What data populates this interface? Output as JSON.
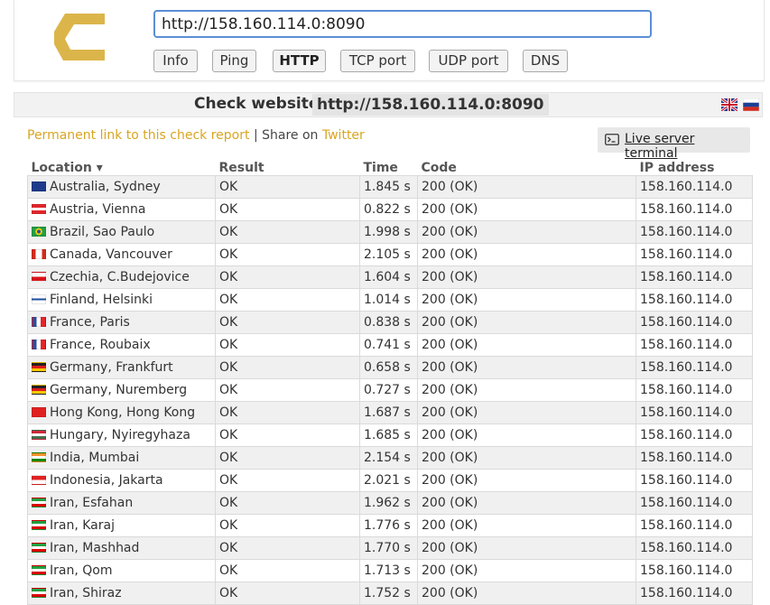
{
  "header": {
    "url_value": "http://158.160.114.0:8090",
    "buttons": [
      "Info",
      "Ping",
      "HTTP",
      "TCP port",
      "UDP port",
      "DNS"
    ],
    "active_button": "HTTP"
  },
  "title": {
    "label": "Check website",
    "url": "http://158.160.114.0:8090"
  },
  "links": {
    "permanent": "Permanent link to this check report",
    "separator": "|",
    "share": "Share on",
    "twitter": "Twitter",
    "terminal": "Live server terminal"
  },
  "table": {
    "headers": [
      "Location ▾",
      "Result",
      "Time",
      "Code",
      "IP address"
    ],
    "rows": [
      {
        "flag": "au",
        "location": "Australia, Sydney",
        "result": "OK",
        "time": "1.845 s",
        "code": "200 (OK)",
        "ip": "158.160.114.0"
      },
      {
        "flag": "at",
        "location": "Austria, Vienna",
        "result": "OK",
        "time": "0.822 s",
        "code": "200 (OK)",
        "ip": "158.160.114.0"
      },
      {
        "flag": "br",
        "location": "Brazil, Sao Paulo",
        "result": "OK",
        "time": "1.998 s",
        "code": "200 (OK)",
        "ip": "158.160.114.0"
      },
      {
        "flag": "ca",
        "location": "Canada, Vancouver",
        "result": "OK",
        "time": "2.105 s",
        "code": "200 (OK)",
        "ip": "158.160.114.0"
      },
      {
        "flag": "cz",
        "location": "Czechia, C.Budejovice",
        "result": "OK",
        "time": "1.604 s",
        "code": "200 (OK)",
        "ip": "158.160.114.0"
      },
      {
        "flag": "fi",
        "location": "Finland, Helsinki",
        "result": "OK",
        "time": "1.014 s",
        "code": "200 (OK)",
        "ip": "158.160.114.0"
      },
      {
        "flag": "fr",
        "location": "France, Paris",
        "result": "OK",
        "time": "0.838 s",
        "code": "200 (OK)",
        "ip": "158.160.114.0"
      },
      {
        "flag": "fr",
        "location": "France, Roubaix",
        "result": "OK",
        "time": "0.741 s",
        "code": "200 (OK)",
        "ip": "158.160.114.0"
      },
      {
        "flag": "de",
        "location": "Germany, Frankfurt",
        "result": "OK",
        "time": "0.658 s",
        "code": "200 (OK)",
        "ip": "158.160.114.0"
      },
      {
        "flag": "de",
        "location": "Germany, Nuremberg",
        "result": "OK",
        "time": "0.727 s",
        "code": "200 (OK)",
        "ip": "158.160.114.0"
      },
      {
        "flag": "hk",
        "location": "Hong Kong, Hong Kong",
        "result": "OK",
        "time": "1.687 s",
        "code": "200 (OK)",
        "ip": "158.160.114.0"
      },
      {
        "flag": "hu",
        "location": "Hungary, Nyiregyhaza",
        "result": "OK",
        "time": "1.685 s",
        "code": "200 (OK)",
        "ip": "158.160.114.0"
      },
      {
        "flag": "in",
        "location": "India, Mumbai",
        "result": "OK",
        "time": "2.154 s",
        "code": "200 (OK)",
        "ip": "158.160.114.0"
      },
      {
        "flag": "id",
        "location": "Indonesia, Jakarta",
        "result": "OK",
        "time": "2.021 s",
        "code": "200 (OK)",
        "ip": "158.160.114.0"
      },
      {
        "flag": "ir",
        "location": "Iran, Esfahan",
        "result": "OK",
        "time": "1.962 s",
        "code": "200 (OK)",
        "ip": "158.160.114.0"
      },
      {
        "flag": "ir",
        "location": "Iran, Karaj",
        "result": "OK",
        "time": "1.776 s",
        "code": "200 (OK)",
        "ip": "158.160.114.0"
      },
      {
        "flag": "ir",
        "location": "Iran, Mashhad",
        "result": "OK",
        "time": "1.770 s",
        "code": "200 (OK)",
        "ip": "158.160.114.0"
      },
      {
        "flag": "ir",
        "location": "Iran, Qom",
        "result": "OK",
        "time": "1.713 s",
        "code": "200 (OK)",
        "ip": "158.160.114.0"
      },
      {
        "flag": "ir",
        "location": "Iran, Shiraz",
        "result": "OK",
        "time": "1.752 s",
        "code": "200 (OK)",
        "ip": "158.160.114.0"
      }
    ]
  },
  "icons": {
    "logo": "check-host-logo-icon",
    "terminal": "terminal-icon",
    "lang_en": "uk-flag-icon",
    "lang_ru": "russia-flag-icon"
  },
  "colors": {
    "logo": "#dcb54a",
    "link": "#d9a521",
    "input_border": "#5b8ed7"
  }
}
